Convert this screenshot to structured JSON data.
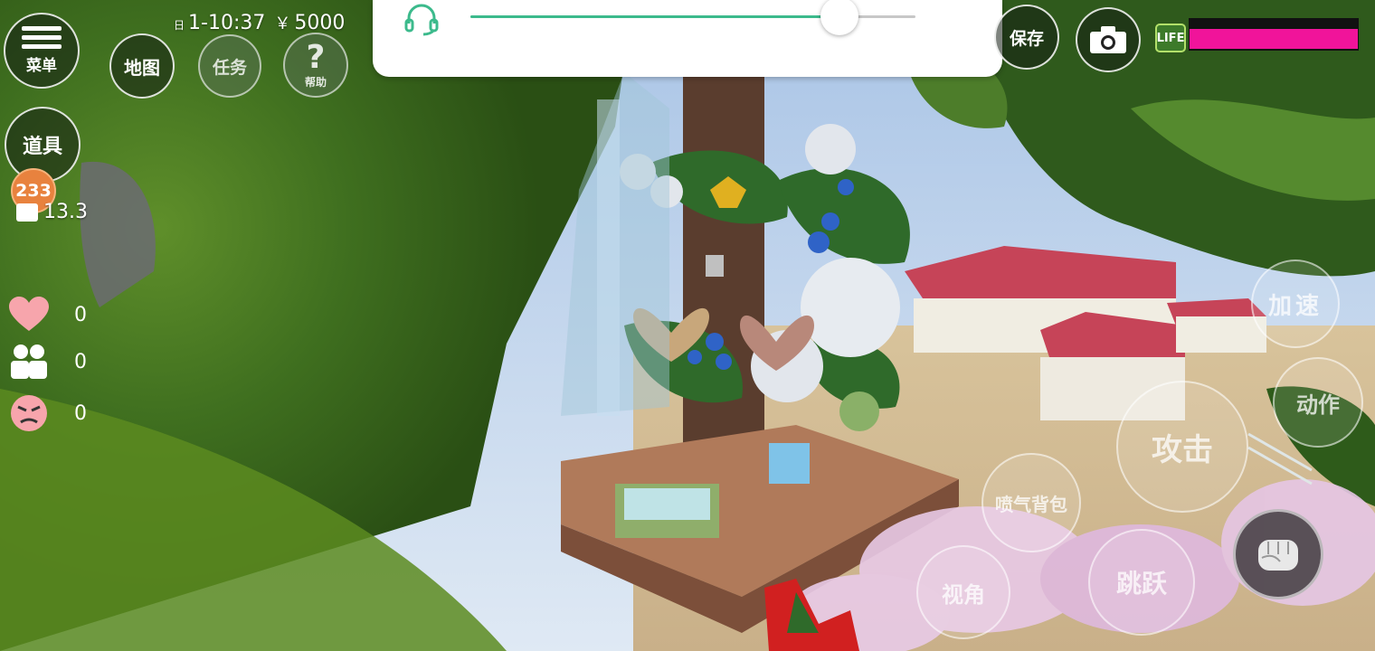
{
  "hud": {
    "clock": "1-10:37",
    "money": "5000",
    "date_mark": "日",
    "currency_mark": "￥",
    "menu_label": "菜单",
    "map_label": "地图",
    "task_label": "任务",
    "help_label": "帮助",
    "help_glyph": "?",
    "items_label": "道具",
    "save_label": "保存",
    "life_label": "LIFE",
    "level": "233",
    "level_value": "13.3"
  },
  "volume": {
    "level": 0.83
  },
  "life": {
    "level": 1.0,
    "color": "#f0149a"
  },
  "stats": [
    {
      "icon": "heart-icon",
      "value": "0"
    },
    {
      "icon": "friends-icon",
      "value": "0"
    },
    {
      "icon": "angry-face-icon",
      "value": "0"
    }
  ],
  "actions": {
    "speed": "加速",
    "motion": "动作",
    "attack": "攻击",
    "jetpack": "喷气背包",
    "jump": "跳跃",
    "view": "视角"
  },
  "colors": {
    "accent_green": "#3cba8c",
    "life_bar": "#f0149a",
    "hud_bg": "rgba(20,30,20,0.55)"
  }
}
